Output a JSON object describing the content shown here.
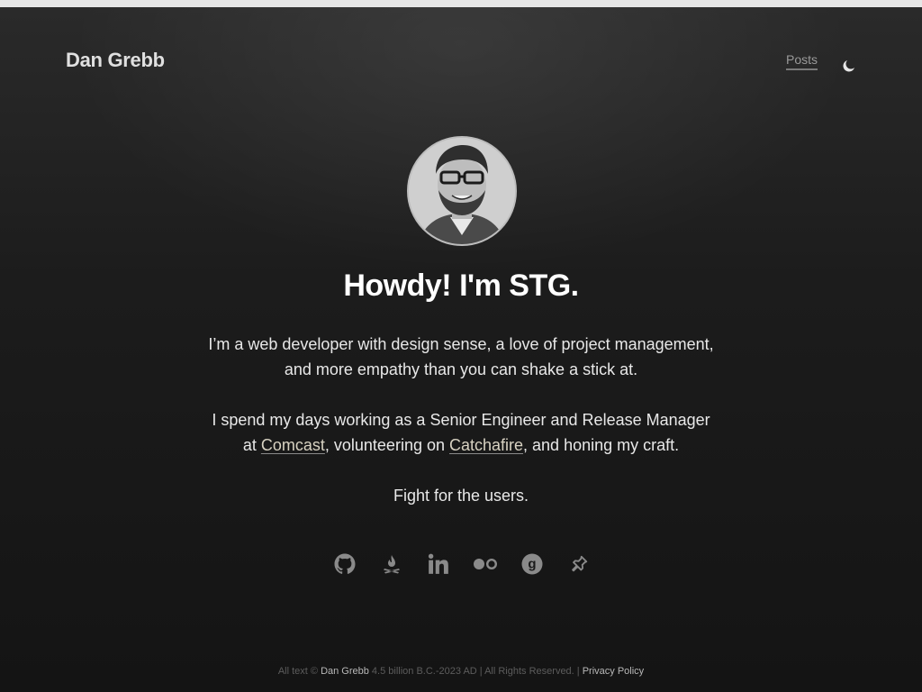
{
  "header": {
    "site_name": "Dan Grebb",
    "nav": [
      {
        "label": "Posts"
      }
    ],
    "theme_toggle_icon": "moon-icon"
  },
  "hero": {
    "avatar_alt": "Dan Grebb",
    "headline": "Howdy! I'm STG.",
    "intro_line1": "I’m a web developer with design sense, a love of project management,",
    "intro_line2": "and more empathy than you can shake a stick at.",
    "work_line1": "I spend my days working as a Senior Engineer and Release Manager",
    "work_at": "at ",
    "work_link1": "Comcast",
    "work_mid": ", volunteering on ",
    "work_link2": "Catchafire",
    "work_end": ", and honing my craft.",
    "tagline": "Fight for the users."
  },
  "socials": [
    {
      "icon": "github-icon"
    },
    {
      "icon": "campfire-icon"
    },
    {
      "icon": "linkedin-icon"
    },
    {
      "icon": "flickr-icon"
    },
    {
      "icon": "goodreads-icon"
    },
    {
      "icon": "pin-icon"
    }
  ],
  "footer": {
    "prefix": "All text © ",
    "name": "Dan Grebb",
    "range": " 4.5 billion B.C.-2023 AD | All Rights Reserved. | ",
    "privacy": "Privacy Policy"
  },
  "colors": {
    "background": "#151515",
    "text": "#e6e6e6",
    "link": "#d8d2c2",
    "icon": "#8a8a8a"
  }
}
